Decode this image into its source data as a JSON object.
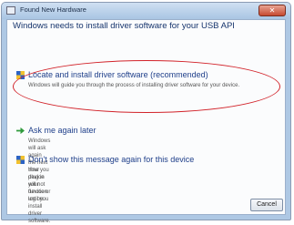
{
  "window": {
    "title": "Found New Hardware",
    "close_label": "✕"
  },
  "heading": "Windows needs to install driver software for your USB API",
  "options": [
    {
      "icon": "shield-icon",
      "title": "Locate and install driver software (recommended)",
      "description": "Windows will guide you through the process of installing driver software for your device."
    },
    {
      "icon": "green-arrow-icon",
      "title": "Ask me again later",
      "description": "Windows will ask again the next time you plug in your device or log on."
    },
    {
      "icon": "shield-icon",
      "title": "Don't show this message again for this device",
      "description": "Your device will not function until you install driver software."
    }
  ],
  "buttons": {
    "cancel_label": "Cancel"
  },
  "colors": {
    "highlight_ellipse": "#d2232a",
    "arrow": "#2f9a3c"
  }
}
